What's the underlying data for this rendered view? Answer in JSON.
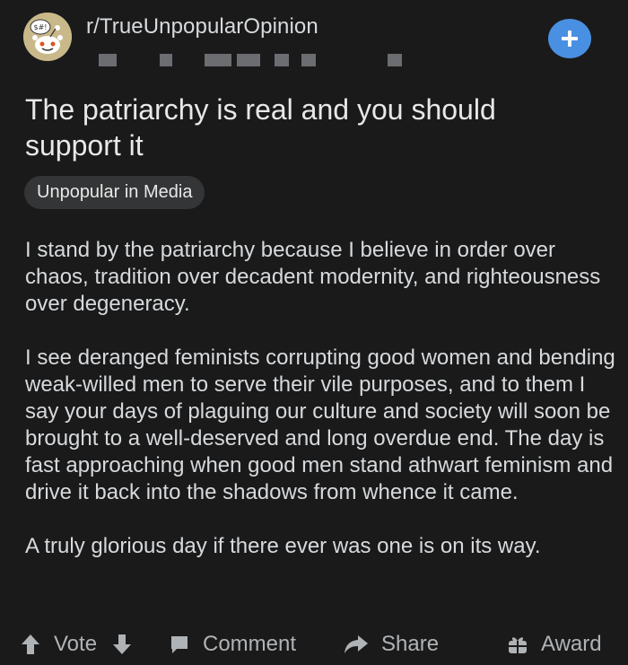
{
  "header": {
    "subreddit": "r/TrueUnpopularOpinion",
    "join_icon": "plus-icon"
  },
  "post": {
    "title": "The patriarchy is real and you should support it",
    "flair": "Unpopular in Media",
    "paragraphs": [
      "I stand by the patriarchy because I believe in order over chaos, tradition over decadent modernity, and righteousness over degeneracy.",
      "I see deranged feminists corrupting good women and bending weak-willed men to serve their vile purposes, and to them I say your days of plaguing our culture and society will soon be brought to a well-deserved and long overdue end. The day is fast approaching when good men stand athwart feminism and drive it back into the shadows from whence it came.",
      "A truly glorious day if there ever was one is on its way."
    ]
  },
  "actions": {
    "vote": "Vote",
    "comment": "Comment",
    "share": "Share",
    "award": "Award"
  },
  "colors": {
    "background": "#1a1a1b",
    "accent": "#4a90e2",
    "flair_bg": "#343536",
    "text": "#d7dadc"
  }
}
